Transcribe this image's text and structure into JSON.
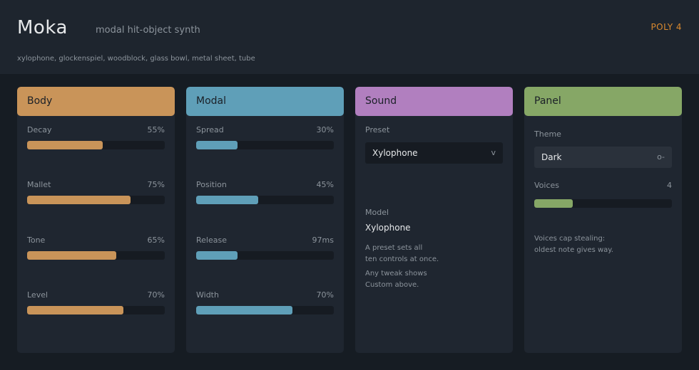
{
  "header": {
    "title": "Moka",
    "subtitle": "modal hit-object synth",
    "poly_badge": "POLY 4",
    "instruments": "xylophone, glockenspiel, woodblock, glass bowl, metal sheet, tube"
  },
  "colors": {
    "body": "#c99459",
    "modal": "#5f9fb8",
    "sound": "#b17fbf",
    "panel": "#86a766",
    "accent": "#d9892e"
  },
  "panels": {
    "body": {
      "title": "Body",
      "params": [
        {
          "label": "Decay",
          "value": "55%",
          "level": 0.55
        },
        {
          "label": "Mallet",
          "value": "75%",
          "level": 0.75
        },
        {
          "label": "Tone",
          "value": "65%",
          "level": 0.65
        },
        {
          "label": "Level",
          "value": "70%",
          "level": 0.7
        }
      ]
    },
    "modal": {
      "title": "Modal",
      "params": [
        {
          "label": "Spread",
          "value": "30%",
          "level": 0.3
        },
        {
          "label": "Position",
          "value": "45%",
          "level": 0.45
        },
        {
          "label": "Release",
          "value": "97ms",
          "level": 0.3
        },
        {
          "label": "Width",
          "value": "70%",
          "level": 0.7
        }
      ]
    },
    "sound": {
      "title": "Sound",
      "preset_label": "Preset",
      "preset_value": "Xylophone",
      "preset_caret": "v",
      "model_label": "Model",
      "model_value": "Xylophone",
      "note1_line1": "A preset sets all",
      "note1_line2": "ten controls at once.",
      "note2_line1": "Any tweak shows",
      "note2_line2": "Custom above."
    },
    "panel": {
      "title": "Panel",
      "theme_label": "Theme",
      "theme_value": "Dark",
      "theme_toggle": "o-",
      "voices_label": "Voices",
      "voices_value": "4",
      "voices_level": 0.28,
      "note_line1": "Voices cap stealing:",
      "note_line2": "oldest note gives way."
    }
  }
}
